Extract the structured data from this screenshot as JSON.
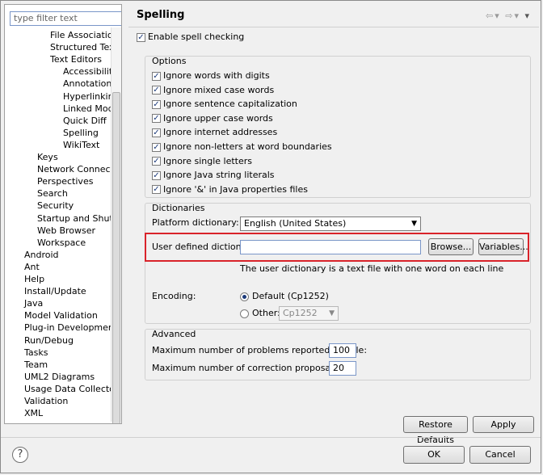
{
  "filter": {
    "placeholder": "type filter text"
  },
  "tree": [
    {
      "label": "File Associations",
      "indent": 3
    },
    {
      "label": "Structured Text E",
      "indent": 3
    },
    {
      "label": "Text Editors",
      "indent": 3
    },
    {
      "label": "Accessibility",
      "indent": 4
    },
    {
      "label": "Annotations",
      "indent": 4
    },
    {
      "label": "Hyperlinking",
      "indent": 4
    },
    {
      "label": "Linked Mode",
      "indent": 4
    },
    {
      "label": "Quick Diff",
      "indent": 4
    },
    {
      "label": "Spelling",
      "indent": 4,
      "selected": true
    },
    {
      "label": "WikiText",
      "indent": 4
    },
    {
      "label": "Keys",
      "indent": 2
    },
    {
      "label": "Network Connection",
      "indent": 2
    },
    {
      "label": "Perspectives",
      "indent": 2
    },
    {
      "label": "Search",
      "indent": 2
    },
    {
      "label": "Security",
      "indent": 2
    },
    {
      "label": "Startup and Shutdow",
      "indent": 2
    },
    {
      "label": "Web Browser",
      "indent": 2
    },
    {
      "label": "Workspace",
      "indent": 2
    },
    {
      "label": "Android",
      "indent": 1
    },
    {
      "label": "Ant",
      "indent": 1
    },
    {
      "label": "Help",
      "indent": 1
    },
    {
      "label": "Install/Update",
      "indent": 1
    },
    {
      "label": "Java",
      "indent": 1
    },
    {
      "label": "Model Validation",
      "indent": 1
    },
    {
      "label": "Plug-in Development",
      "indent": 1
    },
    {
      "label": "Run/Debug",
      "indent": 1
    },
    {
      "label": "Tasks",
      "indent": 1
    },
    {
      "label": "Team",
      "indent": 1
    },
    {
      "label": "UML2 Diagrams",
      "indent": 1
    },
    {
      "label": "Usage Data Collector",
      "indent": 1
    },
    {
      "label": "Validation",
      "indent": 1
    },
    {
      "label": "XML",
      "indent": 1
    }
  ],
  "page": {
    "title": "Spelling",
    "enable_label": "Enable spell checking",
    "options_title": "Options",
    "options": [
      "Ignore words with digits",
      "Ignore mixed case words",
      "Ignore sentence capitalization",
      "Ignore upper case words",
      "Ignore internet addresses",
      "Ignore non-letters at word boundaries",
      "Ignore single letters",
      "Ignore Java string literals",
      "Ignore '&' in Java properties files"
    ],
    "dictionaries_title": "Dictionaries",
    "platform_label": "Platform dictionary:",
    "platform_value": "English (United States)",
    "user_dict_label": "User defined dictionary:",
    "user_dict_value": "",
    "browse_label": "Browse...",
    "variables_label": "Variables...",
    "user_dict_hint": "The user dictionary is a text file with one word on each line",
    "encoding_label": "Encoding:",
    "default_encoding_label": "Default (Cp1252)",
    "other_label": "Other:",
    "other_value": "Cp1252",
    "advanced_title": "Advanced",
    "max_problems_label": "Maximum number of problems reported per file:",
    "max_problems_value": "100",
    "max_proposals_label": "Maximum number of correction proposals:",
    "max_proposals_value": "20",
    "restore_label": "Restore Defaults",
    "apply_label": "Apply"
  },
  "footer": {
    "ok_label": "OK",
    "cancel_label": "Cancel",
    "help_glyph": "?"
  },
  "colors": {
    "highlight": "#d9232a"
  }
}
